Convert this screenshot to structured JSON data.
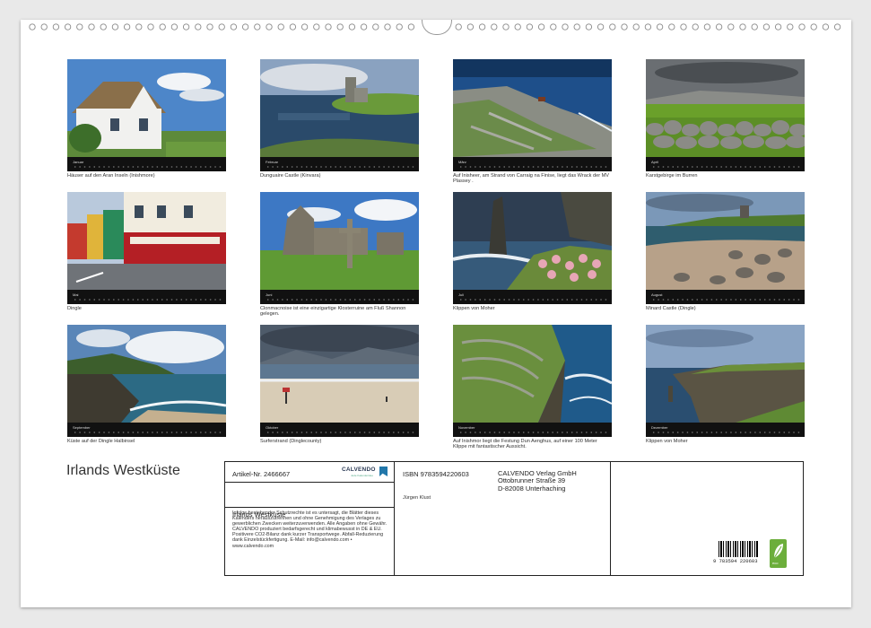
{
  "cover_title": "Irlands Westküste",
  "months": [
    {
      "month": "Januar",
      "caption": "Häuser auf den Aran Inseln (Inishmore)"
    },
    {
      "month": "Februar",
      "caption": "Dunguaire Castle (Kinvara)"
    },
    {
      "month": "März",
      "caption": "Auf Inisheer, am Strand von Carraig na Finise, liegt das Wrack der MV Plassey ."
    },
    {
      "month": "April",
      "caption": "Karstgebirge im Burren"
    },
    {
      "month": "Mai",
      "caption": "Dingle"
    },
    {
      "month": "Juni",
      "caption": "Clonmacnoise ist eine einzigartige Klosterruine am Fluß Shannon gelegen."
    },
    {
      "month": "Juli",
      "caption": "Klippen von Moher"
    },
    {
      "month": "August",
      "caption": "Minard Castle (Dingle)"
    },
    {
      "month": "September",
      "caption": "Küste auf der Dingle Halbinsel"
    },
    {
      "month": "Oktober",
      "caption": "Surferstrand (Dinglecounty)"
    },
    {
      "month": "November",
      "caption": "Auf Inishmor liegt die Festung Dun Aenghus, auf einer 100 Meter Klippe mit fantastischer Aussicht."
    },
    {
      "month": "Dezember",
      "caption": "Klippen von Moher"
    }
  ],
  "info": {
    "article": "Artikel-Nr. 2466667",
    "brand": "CALVENDO",
    "brand_sub": "Jede Kalenderidee",
    "calendar_name": "Irlands Westküste",
    "legal": "Infolge bestehender Schutzrechte ist es untersagt, die Blätter dieses Kalenders herauszutrennen und ohne Genehmigung des Verlages zu gewerblichen Zwecken weiterzuverwenden. Alle Angaben ohne Gewähr. CALVENDO produziert bedarfsgerecht und klimabewusst in DE & EU. Positivere CO2-Bilanz dank kurzer Transportwege. Abfall-Reduzierung dank Einzelstückfertigung. E-Mail: info@calvendo.com • www.calvendo.com",
    "isbn": "ISBN 9783594220603",
    "author": "Jürgen Klust",
    "publisher_1": "CALVENDO Verlag GmbH",
    "publisher_2": "Ottobrunner Straße 39",
    "publisher_3": "D-82008 Unterhaching",
    "barcode_number": "9 783594 220603",
    "eco_label": "eco"
  },
  "colors": {
    "strip": "#111111",
    "page": "#ffffff",
    "eco": "#6cae3b",
    "brand": "#2b3a55"
  }
}
